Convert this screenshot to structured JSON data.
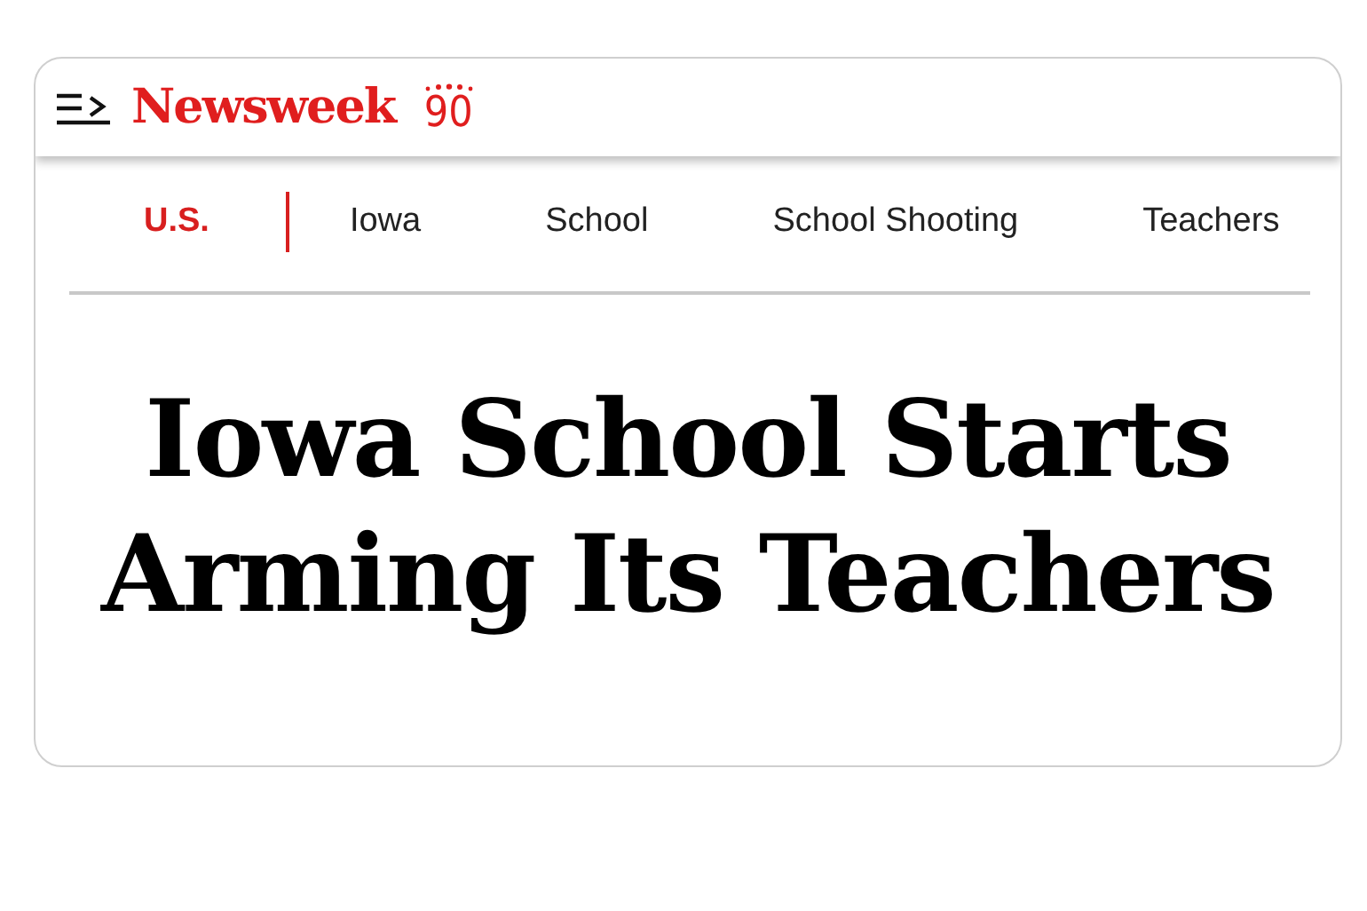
{
  "header": {
    "logo": "Newsweek",
    "anniversary": "90"
  },
  "tags": [
    {
      "label": "U.S.",
      "selected": true
    },
    {
      "label": "Iowa",
      "selected": false
    },
    {
      "label": "School",
      "selected": false
    },
    {
      "label": "School Shooting",
      "selected": false
    },
    {
      "label": "Teachers",
      "selected": false
    }
  ],
  "headline": "Iowa School Starts Arming Its Teachers"
}
